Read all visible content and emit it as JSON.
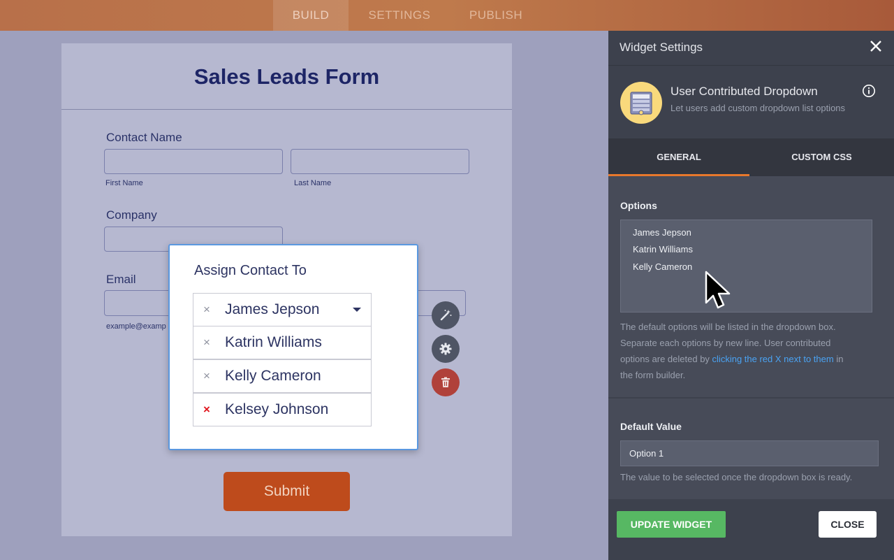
{
  "topnav": {
    "tabs": [
      "BUILD",
      "SETTINGS",
      "PUBLISH"
    ]
  },
  "form": {
    "title": "Sales Leads Form",
    "contact_label": "Contact Name",
    "first_name_sub": "First Name",
    "last_name_sub": "Last Name",
    "company_label": "Company",
    "email_label": "Email",
    "email_sub": "example@examp",
    "submit_label": "Submit"
  },
  "popup": {
    "title": "Assign Contact To",
    "options": [
      {
        "name": "James Jepson",
        "remove": "×"
      },
      {
        "name": "Katrin Williams",
        "remove": "×"
      },
      {
        "name": "Kelly Cameron",
        "remove": "×"
      },
      {
        "name": "Kelsey Johnson",
        "remove": "×"
      }
    ]
  },
  "panel": {
    "title": "Widget Settings",
    "widget_name": "User Contributed Dropdown",
    "widget_desc": "Let users add custom dropdown list options",
    "tabs": [
      "GENERAL",
      "CUSTOM CSS"
    ],
    "options_title": "Options",
    "options_lines": [
      "James Jepson",
      "Katrin Williams",
      "Kelly Cameron"
    ],
    "options_help_1": "The default options will be listed in the dropdown box.",
    "options_help_2": "Separate each options by new line. User contributed",
    "options_help_3a": "options are deleted by ",
    "options_help_link": "clicking the red X next to them",
    "options_help_3b": " in",
    "options_help_4": "the form builder.",
    "default_title": "Default Value",
    "default_value": "Option 1",
    "default_help": "The value to be selected once the dropdown box is ready.",
    "update_label": "UPDATE WIDGET",
    "close_label": "CLOSE"
  },
  "colors": {
    "accent": "#e8782c",
    "update": "#57b863",
    "submit": "#be4b1c",
    "link": "#4aa3f3",
    "remove_red": "#e0161e"
  }
}
